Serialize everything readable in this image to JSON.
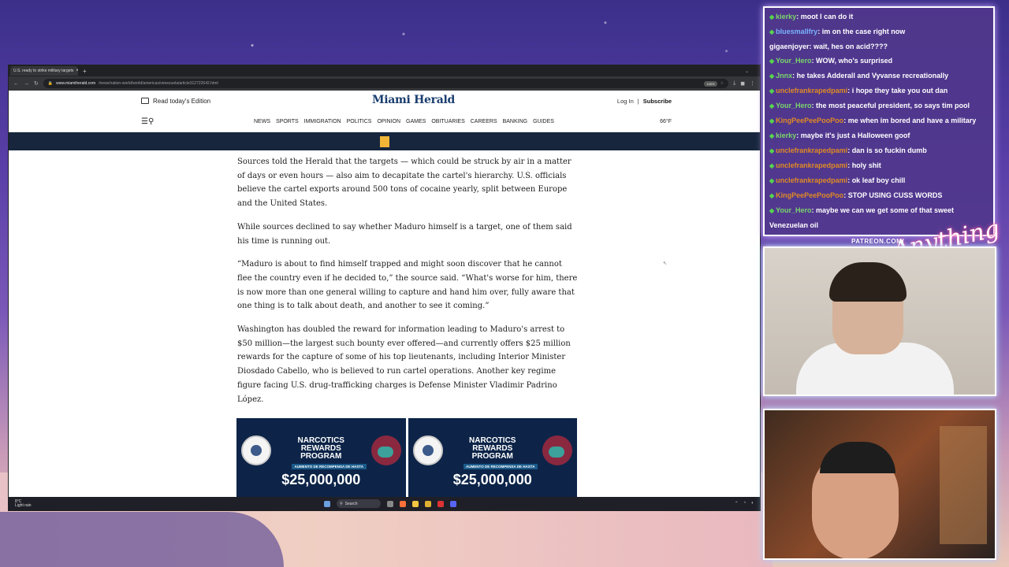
{
  "browser": {
    "tab_title": "U.S. ready to strike military targets",
    "url_host": "www.miamiherald.com",
    "url_path": "/news/nation-world/world/americas/venezuela/article312722642.html",
    "zoom": "100%"
  },
  "site": {
    "edition_label": "Read today's Edition",
    "logo_text": "Miami Herald",
    "login": "Log In",
    "separator": "|",
    "subscribe": "Subscribe",
    "nav": [
      "NEWS",
      "SPORTS",
      "IMMIGRATION",
      "POLITICS",
      "OPINION",
      "GAMES",
      "OBITUARIES",
      "CAREERS",
      "BANKING",
      "GUIDES"
    ],
    "temperature": "66°F"
  },
  "article": {
    "paragraphs": [
      "Sources told the Herald that the targets — which could be struck by air in a matter of days or even hours — also aim to decapitate the cartel's hierarchy. U.S. officials believe the cartel exports around 500 tons of cocaine yearly, split between Europe and the United States.",
      "While sources declined to say whether Maduro himself is a target, one of them said his time is running out.",
      "“Maduro is about to find himself trapped and might soon discover that he cannot flee the country even if he decided to,” the source said. “What's worse for him, there is now more than one general willing to capture and hand him over, fully aware that one thing is to talk about death, and another to see it coming.”",
      "Washington has doubled the reward for information leading to Maduro's arrest to $50 million—the largest such bounty ever offered—and currently offers $25 million rewards for the capture of some of his top lieutenants, including Interior Minister Diosdado Cabello, who is believed to run cartel operations. Another key regime figure facing U.S. drug-trafficking charges is Defense Minister Vladimir Padrino López."
    ],
    "promo": {
      "line1": "NARCOTICS",
      "line2": "REWARDS",
      "line3": "PROGRAM",
      "sub": "AUMENTO DE RECOMPENSA DE HASTA",
      "amount": "$25,000,000"
    }
  },
  "taskbar": {
    "weather_temp": "8°C",
    "weather_desc": "Light rain",
    "search": "Search"
  },
  "chat": {
    "messages": [
      {
        "user": "kierky",
        "text": "moot I can do it",
        "c": "u"
      },
      {
        "user": "bluesmallfry",
        "text": "im on the case right now",
        "c": "u3"
      },
      {
        "user": "gigaenjoyer",
        "text": "wait, hes on acid????",
        "c": "plain"
      },
      {
        "user": "Your_Hero",
        "text": "WOW, who's surprised",
        "c": "u"
      },
      {
        "user": "Jnnx",
        "text": "he takes Adderall and Vyvanse recreationally",
        "c": "u"
      },
      {
        "user": "unclefrankrapedpami",
        "text": "i hope they take you out dan",
        "c": "u2"
      },
      {
        "user": "Your_Hero",
        "text": "the most peaceful president, so says tim pool",
        "c": "u"
      },
      {
        "user": "KingPeePeePooPoo",
        "text": "me when im bored and have a military",
        "c": "u2"
      },
      {
        "user": "kierky",
        "text": "maybe it's just a Halloween goof",
        "c": "u"
      },
      {
        "user": "unclefrankrapedpami",
        "text": "dan is so fuckin dumb",
        "c": "u2"
      },
      {
        "user": "unclefrankrapedpami",
        "text": "holy shit",
        "c": "u2"
      },
      {
        "user": "unclefrankrapedpami",
        "text": "ok leaf boy chill",
        "c": "u2"
      },
      {
        "user": "KingPeePeePooPoo",
        "text": "STOP USING CUSS WORDS",
        "c": "u2"
      },
      {
        "user": "Your_Hero",
        "text": "maybe we can we get some of that sweet Venezuelan oil",
        "c": "u"
      }
    ]
  },
  "overlay": {
    "patreon": "PATREON.COM/",
    "brand": "Anything Else?"
  }
}
